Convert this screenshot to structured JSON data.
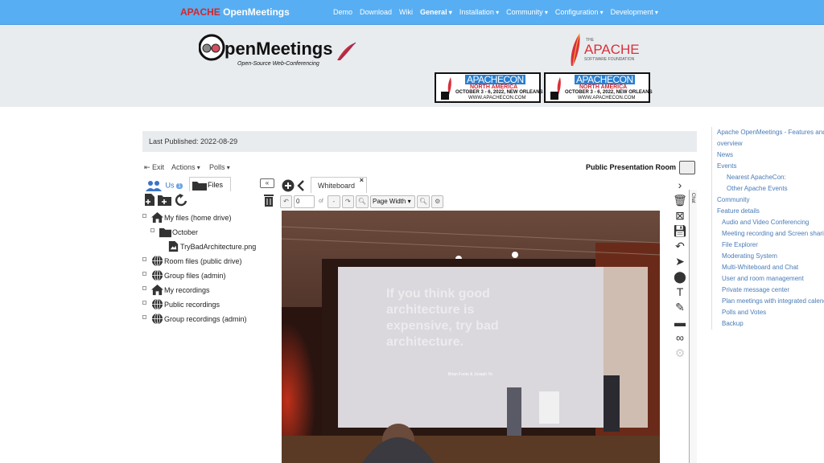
{
  "nav": {
    "brand_apache": "APACHE",
    "brand_om": "OpenMeetings",
    "links": [
      {
        "label": "Demo",
        "dropdown": false,
        "active": false
      },
      {
        "label": "Download",
        "dropdown": false,
        "active": false
      },
      {
        "label": "Wiki",
        "dropdown": false,
        "active": false
      },
      {
        "label": "General",
        "dropdown": true,
        "active": true
      },
      {
        "label": "Installation",
        "dropdown": true,
        "active": false
      },
      {
        "label": "Community",
        "dropdown": true,
        "active": false
      },
      {
        "label": "Configuration",
        "dropdown": true,
        "active": false
      },
      {
        "label": "Development",
        "dropdown": true,
        "active": false
      }
    ]
  },
  "header": {
    "om_logo_text": "penMeetings",
    "om_tagline": "Open-Source Web-Conferencing",
    "apache_the": "THE",
    "apache_word": "APACHE",
    "apache_foundation": "SOFTWARE FOUNDATION",
    "apachecon": {
      "title": "APACHECON",
      "region": "NORTH AMERICA",
      "dates": "OCTOBER 3 - 6, 2022, NEW ORLEANS",
      "url": "WWW.APACHECON.COM"
    }
  },
  "published": "Last Published: 2022-08-29",
  "sidebar": [
    {
      "label": "Apache OpenMeetings - Features and",
      "level": 0
    },
    {
      "label": "overview",
      "level": 0
    },
    {
      "label": "News",
      "level": 0
    },
    {
      "label": "Events",
      "level": 0
    },
    {
      "label": "Nearest ApacheCon:",
      "level": 2
    },
    {
      "label": "Other Apache Events",
      "level": 2
    },
    {
      "label": "Community",
      "level": 0
    },
    {
      "label": "Feature details",
      "level": 0
    },
    {
      "label": "Audio and Video Conferencing",
      "level": 1
    },
    {
      "label": "Meeting recording and Screen sharing",
      "level": 1
    },
    {
      "label": "File Explorer",
      "level": 1
    },
    {
      "label": "Moderating System",
      "level": 1
    },
    {
      "label": "Multi-Whiteboard and Chat",
      "level": 1
    },
    {
      "label": "User and room management",
      "level": 1
    },
    {
      "label": "Private message center",
      "level": 1
    },
    {
      "label": "Plan meetings with integrated calendar",
      "level": 1
    },
    {
      "label": "Polls and Votes",
      "level": 1
    },
    {
      "label": "Backup",
      "level": 1
    }
  ],
  "room": {
    "exit": "Exit",
    "actions": "Actions",
    "polls": "Polls",
    "title": "Public Presentation Room"
  },
  "files_panel": {
    "users_tab": "Us",
    "users_badge": "1",
    "files_tab": "Files",
    "collapse": "«",
    "tree": [
      {
        "label": "My files (home drive)",
        "icon": "home-icon",
        "indent": 0,
        "pm": "-"
      },
      {
        "label": "October",
        "icon": "folder-icon",
        "indent": 1,
        "pm": "-"
      },
      {
        "label": "TryBadArchitecture.png",
        "icon": "image-file-icon",
        "indent": 2,
        "pm": ""
      },
      {
        "label": "Room files (public drive)",
        "icon": "globe-icon",
        "indent": 0,
        "pm": "+"
      },
      {
        "label": "Group files (admin)",
        "icon": "globe-icon",
        "indent": 0,
        "pm": "+"
      },
      {
        "label": "My recordings",
        "icon": "home-icon",
        "indent": 0,
        "pm": "+"
      },
      {
        "label": "Public recordings",
        "icon": "globe-icon",
        "indent": 0,
        "pm": "+"
      },
      {
        "label": "Group recordings (admin)",
        "icon": "globe-icon",
        "indent": 0,
        "pm": "+"
      }
    ]
  },
  "whiteboard": {
    "tab_label": "Whiteboard",
    "close": "×",
    "page_value": "0",
    "of_label": "of",
    "page_total": "-",
    "zoom_option": "Page Width",
    "slide_text": [
      "If you think good",
      "architecture is",
      "expensive, try bad",
      "architecture."
    ],
    "slide_credit": "Brian Foote & Joseph Yo"
  },
  "chat_label": "Chat"
}
